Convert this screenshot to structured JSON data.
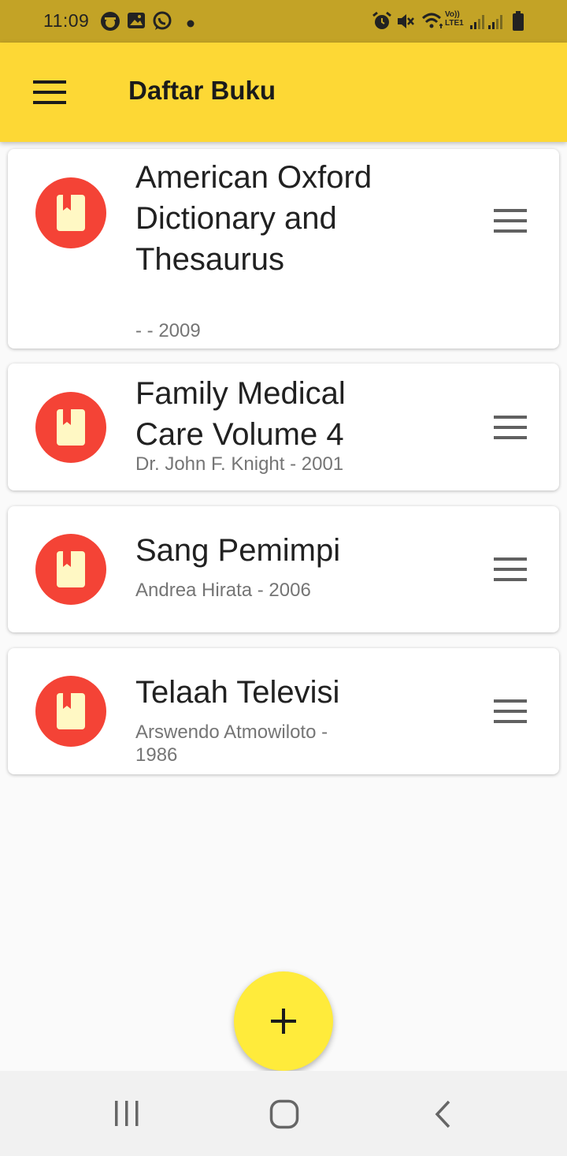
{
  "status_bar": {
    "time": "11:09",
    "icons": [
      "emoji-notification-icon",
      "image-notification-icon",
      "whatsapp-icon",
      "dot-icon",
      "alarm-icon",
      "mute-icon",
      "wifi-icon",
      "volte-signal-icon",
      "battery-icon"
    ],
    "volte_label_top": "Vo))",
    "volte_label_bottom": "LTE1"
  },
  "app_bar": {
    "title": "Daftar Buku",
    "menu_icon": "hamburger-menu-icon",
    "color": "#fdd835"
  },
  "books": [
    {
      "title": "American Oxford Dictionary and Thesaurus",
      "subtitle": "- - 2009"
    },
    {
      "title": "Family Medical Care Volume 4",
      "subtitle": "Dr. John F. Knight - 2001"
    },
    {
      "title": "Sang Pemimpi",
      "subtitle": "Andrea Hirata - 2006"
    },
    {
      "title": "Telaah Televisi",
      "subtitle": "Arswendo Atmowiloto - 1986"
    }
  ],
  "book_icon": "book-icon",
  "avatar_color": "#f44336",
  "row_action_icon": "drag-handle-icon",
  "fab": {
    "icon": "plus-icon",
    "color": "#ffeb3b"
  },
  "nav_bar": {
    "buttons": [
      "recent-apps-icon",
      "home-icon",
      "back-icon"
    ]
  }
}
